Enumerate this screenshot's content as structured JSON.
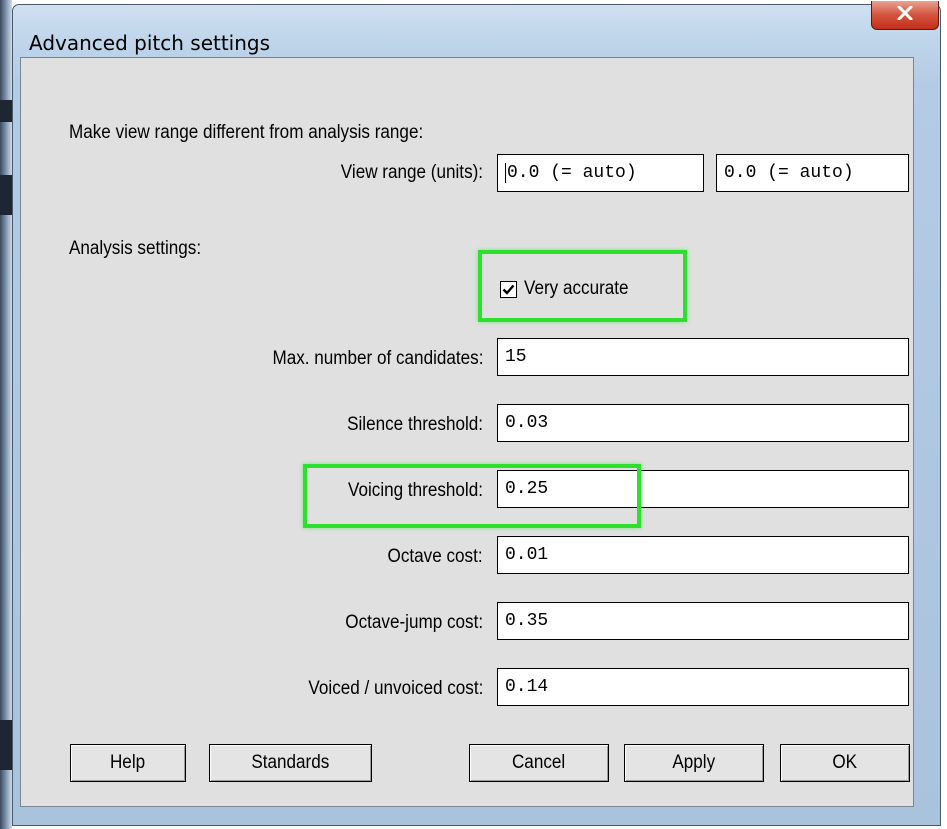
{
  "window": {
    "title": "Advanced pitch settings",
    "close_label": "X"
  },
  "view_range": {
    "section_label": "Make view range different from analysis range:",
    "label": "View range (units):",
    "min_value": "0.0 (= auto)",
    "max_value": "0.0 (= auto)"
  },
  "analysis": {
    "section_label": "Analysis settings:",
    "very_accurate_label": "Very accurate",
    "very_accurate_checked": true,
    "max_candidates_label": "Max. number of candidates:",
    "max_candidates_value": "15",
    "silence_threshold_label": "Silence threshold:",
    "silence_threshold_value": "0.03",
    "voicing_threshold_label": "Voicing threshold:",
    "voicing_threshold_value": "0.25",
    "octave_cost_label": "Octave cost:",
    "octave_cost_value": "0.01",
    "octave_jump_cost_label": "Octave-jump cost:",
    "octave_jump_cost_value": "0.35",
    "voiced_unvoiced_cost_label": "Voiced / unvoiced cost:",
    "voiced_unvoiced_cost_value": "0.14"
  },
  "buttons": {
    "help": "Help",
    "standards": "Standards",
    "cancel": "Cancel",
    "apply": "Apply",
    "ok": "OK"
  },
  "colors": {
    "highlight": "#2ee02e",
    "dialog_background": "#e0e0e0",
    "title_bar": "#bed4ea",
    "close_button": "#c8392a"
  },
  "icons": {
    "close": "close-icon",
    "checkbox": "checkmark-icon"
  }
}
